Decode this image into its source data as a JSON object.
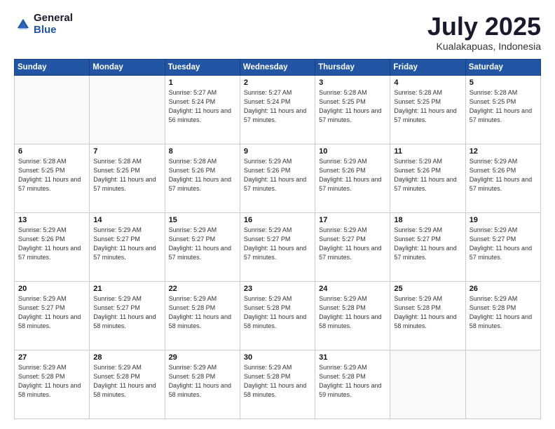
{
  "logo": {
    "general": "General",
    "blue": "Blue"
  },
  "header": {
    "month": "July 2025",
    "location": "Kualakapuas, Indonesia"
  },
  "days_of_week": [
    "Sunday",
    "Monday",
    "Tuesday",
    "Wednesday",
    "Thursday",
    "Friday",
    "Saturday"
  ],
  "weeks": [
    [
      {
        "day": "",
        "info": ""
      },
      {
        "day": "",
        "info": ""
      },
      {
        "day": "1",
        "info": "Sunrise: 5:27 AM\nSunset: 5:24 PM\nDaylight: 11 hours and 56 minutes."
      },
      {
        "day": "2",
        "info": "Sunrise: 5:27 AM\nSunset: 5:24 PM\nDaylight: 11 hours and 57 minutes."
      },
      {
        "day": "3",
        "info": "Sunrise: 5:28 AM\nSunset: 5:25 PM\nDaylight: 11 hours and 57 minutes."
      },
      {
        "day": "4",
        "info": "Sunrise: 5:28 AM\nSunset: 5:25 PM\nDaylight: 11 hours and 57 minutes."
      },
      {
        "day": "5",
        "info": "Sunrise: 5:28 AM\nSunset: 5:25 PM\nDaylight: 11 hours and 57 minutes."
      }
    ],
    [
      {
        "day": "6",
        "info": "Sunrise: 5:28 AM\nSunset: 5:25 PM\nDaylight: 11 hours and 57 minutes."
      },
      {
        "day": "7",
        "info": "Sunrise: 5:28 AM\nSunset: 5:25 PM\nDaylight: 11 hours and 57 minutes."
      },
      {
        "day": "8",
        "info": "Sunrise: 5:28 AM\nSunset: 5:26 PM\nDaylight: 11 hours and 57 minutes."
      },
      {
        "day": "9",
        "info": "Sunrise: 5:29 AM\nSunset: 5:26 PM\nDaylight: 11 hours and 57 minutes."
      },
      {
        "day": "10",
        "info": "Sunrise: 5:29 AM\nSunset: 5:26 PM\nDaylight: 11 hours and 57 minutes."
      },
      {
        "day": "11",
        "info": "Sunrise: 5:29 AM\nSunset: 5:26 PM\nDaylight: 11 hours and 57 minutes."
      },
      {
        "day": "12",
        "info": "Sunrise: 5:29 AM\nSunset: 5:26 PM\nDaylight: 11 hours and 57 minutes."
      }
    ],
    [
      {
        "day": "13",
        "info": "Sunrise: 5:29 AM\nSunset: 5:26 PM\nDaylight: 11 hours and 57 minutes."
      },
      {
        "day": "14",
        "info": "Sunrise: 5:29 AM\nSunset: 5:27 PM\nDaylight: 11 hours and 57 minutes."
      },
      {
        "day": "15",
        "info": "Sunrise: 5:29 AM\nSunset: 5:27 PM\nDaylight: 11 hours and 57 minutes."
      },
      {
        "day": "16",
        "info": "Sunrise: 5:29 AM\nSunset: 5:27 PM\nDaylight: 11 hours and 57 minutes."
      },
      {
        "day": "17",
        "info": "Sunrise: 5:29 AM\nSunset: 5:27 PM\nDaylight: 11 hours and 57 minutes."
      },
      {
        "day": "18",
        "info": "Sunrise: 5:29 AM\nSunset: 5:27 PM\nDaylight: 11 hours and 57 minutes."
      },
      {
        "day": "19",
        "info": "Sunrise: 5:29 AM\nSunset: 5:27 PM\nDaylight: 11 hours and 57 minutes."
      }
    ],
    [
      {
        "day": "20",
        "info": "Sunrise: 5:29 AM\nSunset: 5:27 PM\nDaylight: 11 hours and 58 minutes."
      },
      {
        "day": "21",
        "info": "Sunrise: 5:29 AM\nSunset: 5:27 PM\nDaylight: 11 hours and 58 minutes."
      },
      {
        "day": "22",
        "info": "Sunrise: 5:29 AM\nSunset: 5:28 PM\nDaylight: 11 hours and 58 minutes."
      },
      {
        "day": "23",
        "info": "Sunrise: 5:29 AM\nSunset: 5:28 PM\nDaylight: 11 hours and 58 minutes."
      },
      {
        "day": "24",
        "info": "Sunrise: 5:29 AM\nSunset: 5:28 PM\nDaylight: 11 hours and 58 minutes."
      },
      {
        "day": "25",
        "info": "Sunrise: 5:29 AM\nSunset: 5:28 PM\nDaylight: 11 hours and 58 minutes."
      },
      {
        "day": "26",
        "info": "Sunrise: 5:29 AM\nSunset: 5:28 PM\nDaylight: 11 hours and 58 minutes."
      }
    ],
    [
      {
        "day": "27",
        "info": "Sunrise: 5:29 AM\nSunset: 5:28 PM\nDaylight: 11 hours and 58 minutes."
      },
      {
        "day": "28",
        "info": "Sunrise: 5:29 AM\nSunset: 5:28 PM\nDaylight: 11 hours and 58 minutes."
      },
      {
        "day": "29",
        "info": "Sunrise: 5:29 AM\nSunset: 5:28 PM\nDaylight: 11 hours and 58 minutes."
      },
      {
        "day": "30",
        "info": "Sunrise: 5:29 AM\nSunset: 5:28 PM\nDaylight: 11 hours and 58 minutes."
      },
      {
        "day": "31",
        "info": "Sunrise: 5:29 AM\nSunset: 5:28 PM\nDaylight: 11 hours and 59 minutes."
      },
      {
        "day": "",
        "info": ""
      },
      {
        "day": "",
        "info": ""
      }
    ]
  ]
}
